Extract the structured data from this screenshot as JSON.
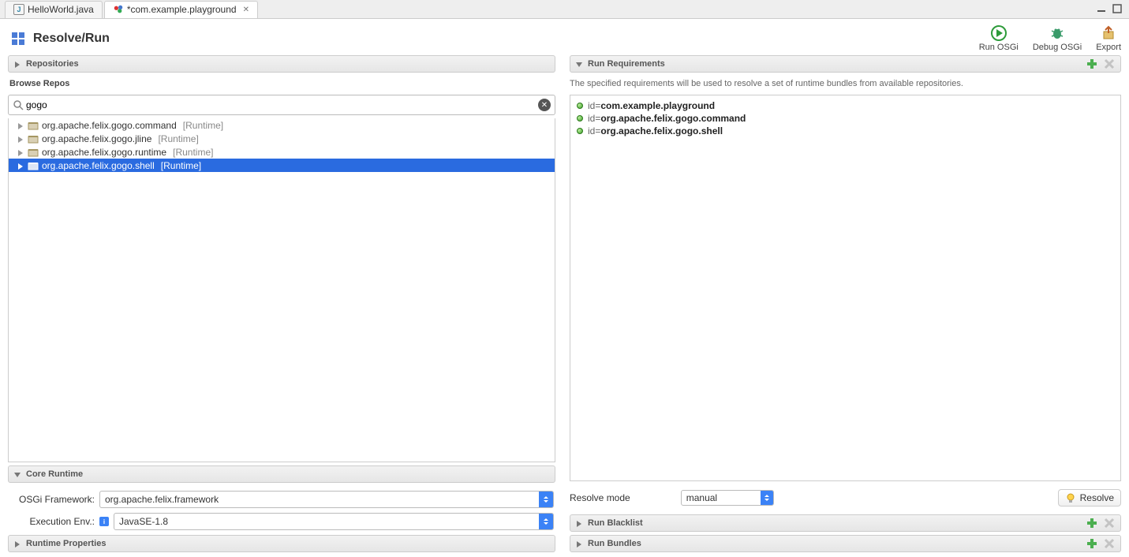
{
  "tabs": {
    "inactive": "HelloWorld.java",
    "active": "*com.example.playground"
  },
  "page_title": "Resolve/Run",
  "toolbar": {
    "run": "Run OSGi",
    "debug": "Debug OSGi",
    "export": "Export"
  },
  "left": {
    "repositories_header": "Repositories",
    "browse_label": "Browse Repos",
    "search_value": "gogo",
    "tree": [
      {
        "name": "org.apache.felix.gogo.command",
        "tag": "[Runtime]",
        "selected": false
      },
      {
        "name": "org.apache.felix.gogo.jline",
        "tag": "[Runtime]",
        "selected": false
      },
      {
        "name": "org.apache.felix.gogo.runtime",
        "tag": "[Runtime]",
        "selected": false
      },
      {
        "name": "org.apache.felix.gogo.shell",
        "tag": "[Runtime]",
        "selected": true
      }
    ],
    "core_runtime_header": "Core Runtime",
    "osgi_framework_label": "OSGi Framework:",
    "osgi_framework_value": "org.apache.felix.framework",
    "exec_env_label": "Execution Env.:",
    "exec_env_value": "JavaSE-1.8",
    "runtime_properties_header": "Runtime Properties"
  },
  "right": {
    "run_requirements_header": "Run Requirements",
    "hint": "The specified requirements will be used to resolve a set of runtime bundles from available repositories.",
    "requirements": [
      {
        "prefix": "id=",
        "value": "com.example.playground"
      },
      {
        "prefix": "id=",
        "value": "org.apache.felix.gogo.command"
      },
      {
        "prefix": "id=",
        "value": "org.apache.felix.gogo.shell"
      }
    ],
    "resolve_mode_label": "Resolve mode",
    "resolve_mode_value": "manual",
    "resolve_button": "Resolve",
    "run_blacklist_header": "Run Blacklist",
    "run_bundles_header": "Run Bundles"
  }
}
